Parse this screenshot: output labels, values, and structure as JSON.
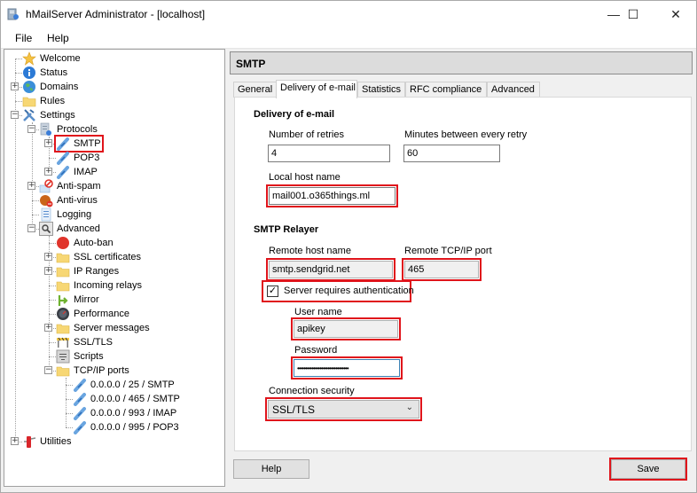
{
  "window": {
    "title": "hMailServer Administrator - [localhost]",
    "minimize_glyph": "—",
    "maximize_glyph": "☐",
    "close_glyph": "✕"
  },
  "menu": [
    "File",
    "Help"
  ],
  "tree": [
    {
      "label": "Welcome",
      "icon": "star-icon"
    },
    {
      "label": "Status",
      "icon": "info-icon"
    },
    {
      "label": "Domains",
      "icon": "globe-icon",
      "expander": "+"
    },
    {
      "label": "Rules",
      "icon": "folder-icon"
    },
    {
      "label": "Settings",
      "icon": "tools-icon",
      "expander": "−"
    },
    {
      "label": "Protocols",
      "icon": "protocols-icon",
      "expander": "−"
    },
    {
      "label": "SMTP",
      "icon": "plug-icon",
      "expander": "+",
      "selected": true
    },
    {
      "label": "POP3",
      "icon": "plug-icon"
    },
    {
      "label": "IMAP",
      "icon": "plug-icon",
      "expander": "+"
    },
    {
      "label": "Anti-spam",
      "icon": "anti-spam-icon",
      "expander": "+"
    },
    {
      "label": "Anti-virus",
      "icon": "anti-virus-icon"
    },
    {
      "label": "Logging",
      "icon": "log-icon"
    },
    {
      "label": "Advanced",
      "icon": "magnifier-icon",
      "expander": "−"
    },
    {
      "label": "Auto-ban",
      "icon": "red-circle-icon"
    },
    {
      "label": "SSL certificates",
      "icon": "folder-icon",
      "expander": "+"
    },
    {
      "label": "IP Ranges",
      "icon": "folder-icon",
      "expander": "+"
    },
    {
      "label": "Incoming relays",
      "icon": "folder-icon"
    },
    {
      "label": "Mirror",
      "icon": "mirror-icon"
    },
    {
      "label": "Performance",
      "icon": "gauge-icon"
    },
    {
      "label": "Server messages",
      "icon": "folder-icon",
      "expander": "+"
    },
    {
      "label": "SSL/TLS",
      "icon": "barrier-icon"
    },
    {
      "label": "Scripts",
      "icon": "script-icon"
    },
    {
      "label": "TCP/IP ports",
      "icon": "folder-icon",
      "expander": "−"
    },
    {
      "label": "0.0.0.0 / 25 / SMTP",
      "icon": "plug-icon"
    },
    {
      "label": "0.0.0.0 / 465 / SMTP",
      "icon": "plug-icon"
    },
    {
      "label": "0.0.0.0 / 993 / IMAP",
      "icon": "plug-icon"
    },
    {
      "label": "0.0.0.0 / 995 / POP3",
      "icon": "plug-icon"
    },
    {
      "label": "Utilities",
      "icon": "utilities-icon",
      "expander": "+"
    }
  ],
  "panel": {
    "title": "SMTP",
    "tabs": [
      "General",
      "Delivery of e-mail",
      "Statistics",
      "RFC compliance",
      "Advanced"
    ],
    "active_tab": "Delivery of e-mail",
    "delivery": {
      "section_title": "Delivery of e-mail",
      "retries_label": "Number of retries",
      "retries_value": "4",
      "minutes_label": "Minutes between every retry",
      "minutes_value": "60",
      "local_host_label": "Local host name",
      "local_host_value": "mail001.o365things.ml"
    },
    "relayer": {
      "section_title": "SMTP Relayer",
      "remote_host_label": "Remote host name",
      "remote_host_value": "smtp.sendgrid.net",
      "remote_port_label": "Remote TCP/IP port",
      "remote_port_value": "465",
      "auth_label": "Server requires authentication",
      "auth_checked": true,
      "check_glyph": "✓",
      "username_label": "User name",
      "username_value": "apikey",
      "password_label": "Password",
      "password_value": "••••••••••••••••••••••••••••••••",
      "security_label": "Connection security",
      "security_value": "SSL/TLS",
      "chevron_glyph": "⌄"
    },
    "help_label": "Help",
    "save_label": "Save"
  }
}
